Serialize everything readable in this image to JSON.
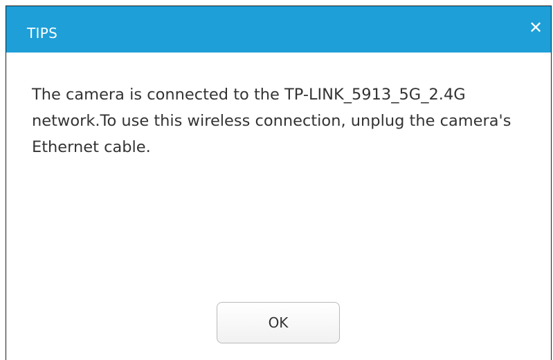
{
  "dialog": {
    "title": "TIPS",
    "close_icon": "close-icon",
    "close_glyph": "✕",
    "message": "The camera is connected to the TP-LINK_5913_5G_2.4G network.To use this wireless connection, unplug the camera's Ethernet cable.",
    "ok_label": "OK"
  },
  "colors": {
    "titlebar": "#1e9fd8",
    "title_text": "#ffffff",
    "body_text": "#333333",
    "button_border": "#b9b9b9"
  }
}
